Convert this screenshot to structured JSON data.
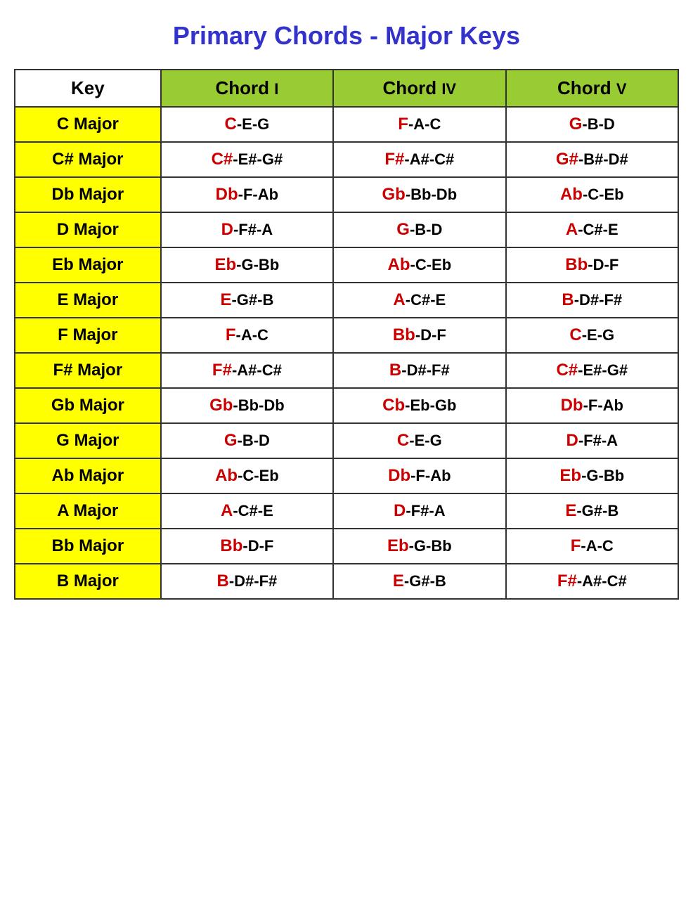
{
  "title": "Primary Chords - Major Keys",
  "headers": {
    "key": "Key",
    "chord1": "Chord",
    "chord1_roman": "I",
    "chord4": "Chord",
    "chord4_roman": "IV",
    "chord5": "Chord",
    "chord5_roman": "V"
  },
  "rows": [
    {
      "key": "C Major",
      "chord1_root": "C",
      "chord1_rest": "-E-G",
      "chord4_root": "F",
      "chord4_rest": "-A-C",
      "chord5_root": "G",
      "chord5_rest": "-B-D"
    },
    {
      "key": "C# Major",
      "chord1_root": "C#",
      "chord1_rest": "-E#-G#",
      "chord4_root": "F#",
      "chord4_rest": "-A#-C#",
      "chord5_root": "G#",
      "chord5_rest": "-B#-D#"
    },
    {
      "key": "Db Major",
      "chord1_root": "Db",
      "chord1_rest": "-F-Ab",
      "chord4_root": "Gb",
      "chord4_rest": "-Bb-Db",
      "chord5_root": "Ab",
      "chord5_rest": "-C-Eb"
    },
    {
      "key": "D Major",
      "chord1_root": "D",
      "chord1_rest": "-F#-A",
      "chord4_root": "G",
      "chord4_rest": "-B-D",
      "chord5_root": "A",
      "chord5_rest": "-C#-E"
    },
    {
      "key": "Eb Major",
      "chord1_root": "Eb",
      "chord1_rest": "-G-Bb",
      "chord4_root": "Ab",
      "chord4_rest": "-C-Eb",
      "chord5_root": "Bb",
      "chord5_rest": "-D-F"
    },
    {
      "key": "E Major",
      "chord1_root": "E",
      "chord1_rest": "-G#-B",
      "chord4_root": "A",
      "chord4_rest": "-C#-E",
      "chord5_root": "B",
      "chord5_rest": "-D#-F#"
    },
    {
      "key": "F Major",
      "chord1_root": "F",
      "chord1_rest": "-A-C",
      "chord4_root": "Bb",
      "chord4_rest": "-D-F",
      "chord5_root": "C",
      "chord5_rest": "-E-G"
    },
    {
      "key": "F# Major",
      "chord1_root": "F#",
      "chord1_rest": "-A#-C#",
      "chord4_root": "B",
      "chord4_rest": "-D#-F#",
      "chord5_root": "C#",
      "chord5_rest": "-E#-G#"
    },
    {
      "key": "Gb Major",
      "chord1_root": "Gb",
      "chord1_rest": "-Bb-Db",
      "chord4_root": "Cb",
      "chord4_rest": "-Eb-Gb",
      "chord5_root": "Db",
      "chord5_rest": "-F-Ab"
    },
    {
      "key": "G Major",
      "chord1_root": "G",
      "chord1_rest": "-B-D",
      "chord4_root": "C",
      "chord4_rest": "-E-G",
      "chord5_root": "D",
      "chord5_rest": "-F#-A"
    },
    {
      "key": "Ab Major",
      "chord1_root": "Ab",
      "chord1_rest": "-C-Eb",
      "chord4_root": "Db",
      "chord4_rest": "-F-Ab",
      "chord5_root": "Eb",
      "chord5_rest": "-G-Bb"
    },
    {
      "key": "A Major",
      "chord1_root": "A",
      "chord1_rest": "-C#-E",
      "chord4_root": "D",
      "chord4_rest": "-F#-A",
      "chord5_root": "E",
      "chord5_rest": "-G#-B"
    },
    {
      "key": "Bb Major",
      "chord1_root": "Bb",
      "chord1_rest": "-D-F",
      "chord4_root": "Eb",
      "chord4_rest": "-G-Bb",
      "chord5_root": "F",
      "chord5_rest": "-A-C"
    },
    {
      "key": "B Major",
      "chord1_root": "B",
      "chord1_rest": "-D#-F#",
      "chord4_root": "E",
      "chord4_rest": "-G#-B",
      "chord5_root": "F#",
      "chord5_rest": "-A#-C#"
    }
  ]
}
